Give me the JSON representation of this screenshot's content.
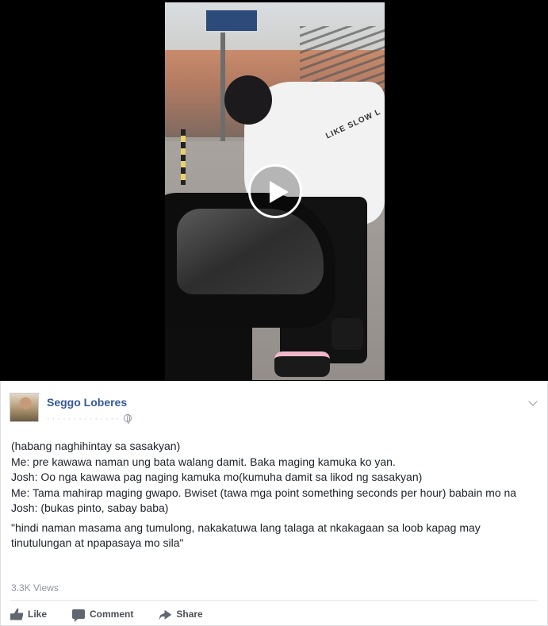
{
  "video": {
    "shirt_text": "LIKE SLOW L",
    "play_button": "play"
  },
  "post": {
    "author": "Seggo Loberes",
    "lines": [
      "(habang naghihintay sa sasakyan)",
      "Me: pre kawawa naman ung bata walang damit. Baka maging kamuka ko yan.",
      "Josh: Oo nga kawawa pag naging kamuka mo(kumuha damit sa likod ng sasakyan)",
      "Me: Tama mahirap maging gwapo. Bwiset (tawa mga point something seconds per hour) babain mo na",
      "Josh: (bukas pinto, sabay baba)"
    ],
    "quote": "\"hindi naman masama ang tumulong, nakakatuwa lang talaga at nkakagaan sa loob kapag may tinutulungan at npapasaya mo sila\"",
    "views": "3.3K Views"
  },
  "actions": {
    "like": "Like",
    "comment": "Comment",
    "share": "Share"
  }
}
